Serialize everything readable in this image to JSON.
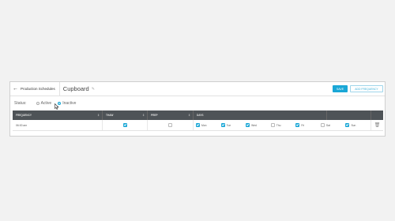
{
  "header": {
    "back_label": "Production Schedules",
    "title": "Cupboard",
    "save_label": "SAVE",
    "add_frequency_label": "ADD FREQUENCY"
  },
  "status": {
    "label": "Status:",
    "options": [
      {
        "label": "Active",
        "selected": false
      },
      {
        "label": "Inactive",
        "selected": true
      }
    ]
  },
  "table": {
    "columns": [
      "FREQUENCY",
      "THAW",
      "PREP",
      "DAYS"
    ],
    "rows": [
      {
        "frequency": "06:00 am",
        "thaw": true,
        "prep": false,
        "days": [
          {
            "label": "Mon",
            "checked": true
          },
          {
            "label": "Tue",
            "checked": true
          },
          {
            "label": "Wed",
            "checked": true
          },
          {
            "label": "Thu",
            "checked": false
          },
          {
            "label": "Fri",
            "checked": true
          },
          {
            "label": "Sat",
            "checked": false
          },
          {
            "label": "Sun",
            "checked": true
          }
        ]
      }
    ]
  },
  "icons": {
    "back": "arrow-left-icon",
    "edit": "pencil-icon",
    "delete": "trash-icon",
    "sort": "sort-icon"
  },
  "colors": {
    "accent": "#1aa7d6",
    "table_header": "#4e5357"
  }
}
